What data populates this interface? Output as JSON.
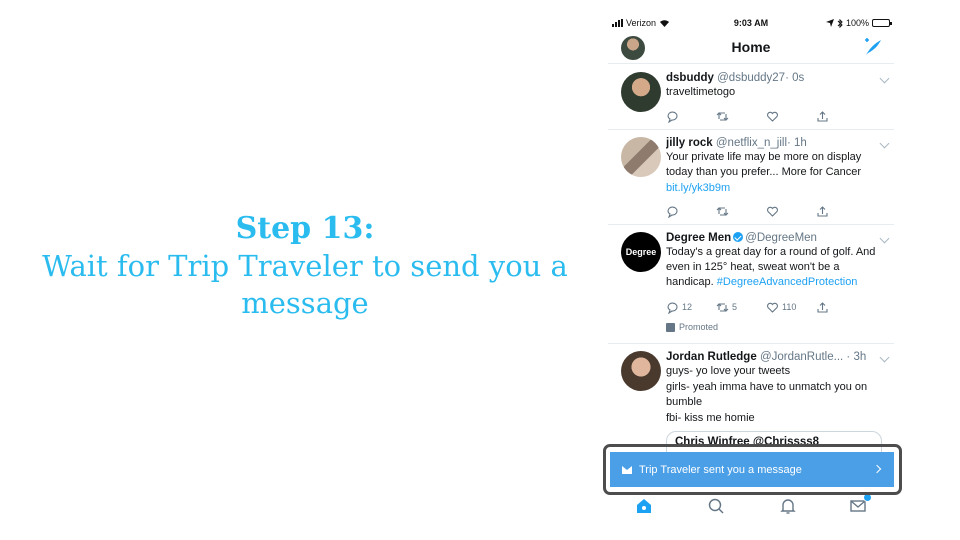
{
  "step": {
    "title": "Step 13:",
    "description": "Wait for Trip Traveler to send you a message"
  },
  "status_bar": {
    "carrier": "Verizon",
    "time": "9:03 AM",
    "battery": "100%"
  },
  "nav": {
    "title": "Home"
  },
  "tweets": [
    {
      "name": "dsbuddy",
      "handle": "@dsbuddy27",
      "time": "· 0s",
      "text": "traveltimetogo"
    },
    {
      "name": "jilly rock",
      "handle": "@netflix_n_jill",
      "time": "· 1h",
      "text": "Your private life may be more on display today than you prefer... More for Cancer",
      "link": "bit.ly/yk3b9m"
    },
    {
      "name": "Degree Men",
      "handle": "@DegreeMen",
      "text": "Today's a great day for a round of golf. And even in 125° heat, sweat won't be a handicap.",
      "hashtag": "#DegreeAdvancedProtection",
      "replies": "12",
      "retweets": "5",
      "likes": "110",
      "promoted": "Promoted",
      "avatar_text": "Degree"
    },
    {
      "name": "Jordan Rutledge",
      "handle": "@JordanRutle...",
      "time": "· 3h",
      "lines": [
        "guys- yo love your tweets",
        "girls- yeah imma have to unmatch you on bumble",
        "fbi- kiss me homie"
      ],
      "quote": "Chris Winfree @Chrissss8"
    }
  ],
  "toast": {
    "text": "Trip Traveler sent you a message"
  },
  "colors": {
    "accent": "#1da1f2",
    "step_text": "#2bbcef",
    "toast_bg": "#4a9fe7"
  }
}
